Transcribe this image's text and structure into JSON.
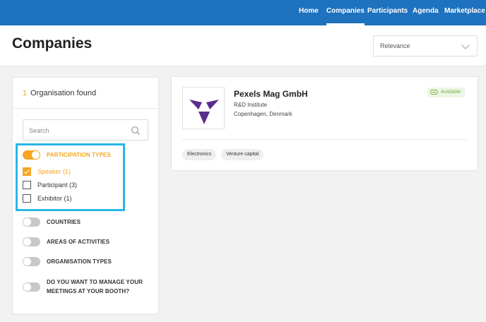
{
  "nav": {
    "items": [
      {
        "label": "Home",
        "active": false
      },
      {
        "label": "Companies",
        "active": true
      },
      {
        "label": "Participants",
        "active": false
      },
      {
        "label": "Agenda",
        "active": false
      },
      {
        "label": "Marketplace",
        "active": false
      }
    ]
  },
  "header": {
    "title": "Companies",
    "sort": {
      "selected": "Relevance"
    }
  },
  "sidebar": {
    "found_count": "1",
    "found_label": "Organisation found",
    "search": {
      "placeholder": "Search",
      "value": ""
    },
    "filters": [
      {
        "label": "PARTICIPATION TYPES",
        "enabled": true
      },
      {
        "label": "COUNTRIES",
        "enabled": false
      },
      {
        "label": "AREAS OF ACTIVITIES",
        "enabled": false
      },
      {
        "label": "ORGANISATION TYPES",
        "enabled": false
      },
      {
        "label": "DO YOU WANT TO MANAGE YOUR MEETINGS AT YOUR BOOTH?",
        "enabled": false
      }
    ],
    "participation_options": [
      {
        "label": "Speaker (1)",
        "checked": true
      },
      {
        "label": "Participant (3)",
        "checked": false
      },
      {
        "label": "Exhibitor (1)",
        "checked": false
      }
    ]
  },
  "result": {
    "name": "Pexels Mag GmbH",
    "type": "R&D Institute",
    "location": "Copenhagen, Denmark",
    "badge": "Available",
    "tags": [
      "Electronics",
      "Venture capital"
    ]
  },
  "colors": {
    "nav_bg": "#1e72be",
    "accent": "#f5a623",
    "available": "#7cb342",
    "highlight": "#29b6e8",
    "logo": "#5b2d8e"
  },
  "icons": {
    "search": "search-icon",
    "chevron": "chevron-down-icon",
    "badge": "handshake-icon",
    "logo": "triangle-logo"
  }
}
